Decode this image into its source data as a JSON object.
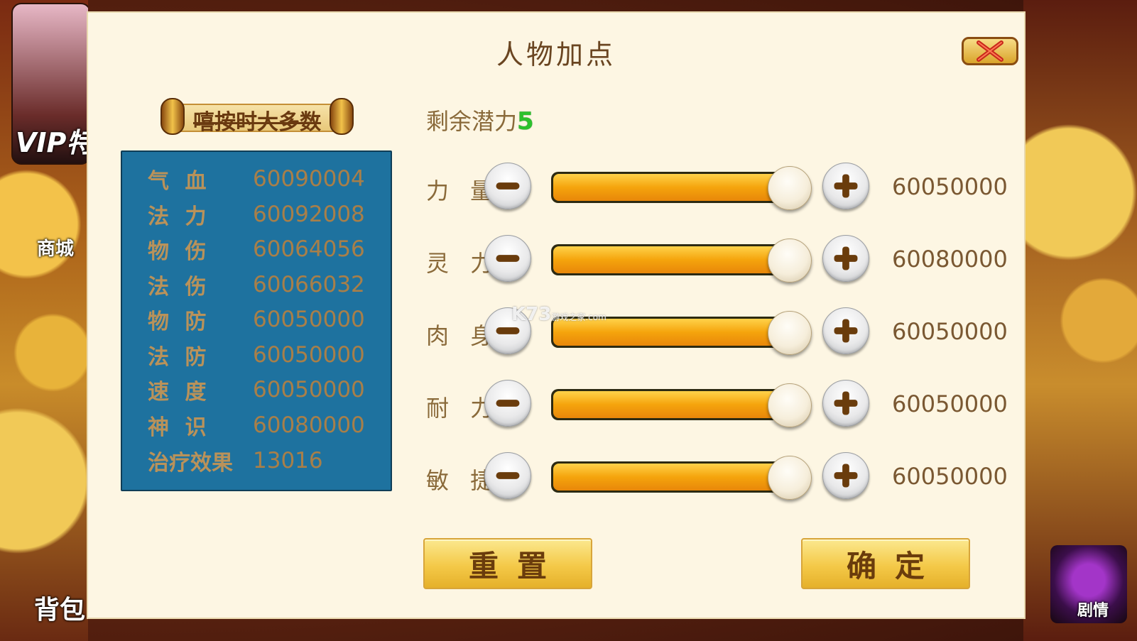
{
  "background": {
    "vip_label": "VIP特",
    "shop_label": "商城",
    "bag_label": "背包",
    "story_label": "剧情"
  },
  "dialog": {
    "title": "人物加点",
    "close_icon": "close-x-icon"
  },
  "left_panel": {
    "banner_label": "嘻按时大多数",
    "stats": [
      {
        "name": "气 血",
        "value": "60090004"
      },
      {
        "name": "法 力",
        "value": "60092008"
      },
      {
        "name": "物 伤",
        "value": "60064056"
      },
      {
        "name": "法 伤",
        "value": "60066032"
      },
      {
        "name": "物 防",
        "value": "60050000"
      },
      {
        "name": "法 防",
        "value": "60050000"
      },
      {
        "name": "速 度",
        "value": "60050000"
      },
      {
        "name": "神 识",
        "value": "60080000"
      },
      {
        "name": "治疗效果",
        "value": "13016"
      }
    ]
  },
  "right_panel": {
    "potential_label": "剩余潜力",
    "potential_value": "5",
    "attributes": [
      {
        "label": "力 量",
        "value": "60050000",
        "slider_fraction": 0.95
      },
      {
        "label": "灵 力",
        "value": "60080000",
        "slider_fraction": 0.95
      },
      {
        "label": "肉 身",
        "value": "60050000",
        "slider_fraction": 0.95
      },
      {
        "label": "耐 力",
        "value": "60050000",
        "slider_fraction": 0.95
      },
      {
        "label": "敏 捷",
        "value": "60050000",
        "slider_fraction": 0.95
      }
    ]
  },
  "actions": {
    "reset_label": "重置",
    "confirm_label": "确定"
  },
  "watermark": {
    "brand": "K73",
    "sub": "游戏之家",
    "domain": ".com"
  },
  "colors": {
    "panel_blue": "#1e729f",
    "potential_green": "#2cc12c",
    "slider_orange": "#f5a40c",
    "button_gold": "#f4c948"
  }
}
